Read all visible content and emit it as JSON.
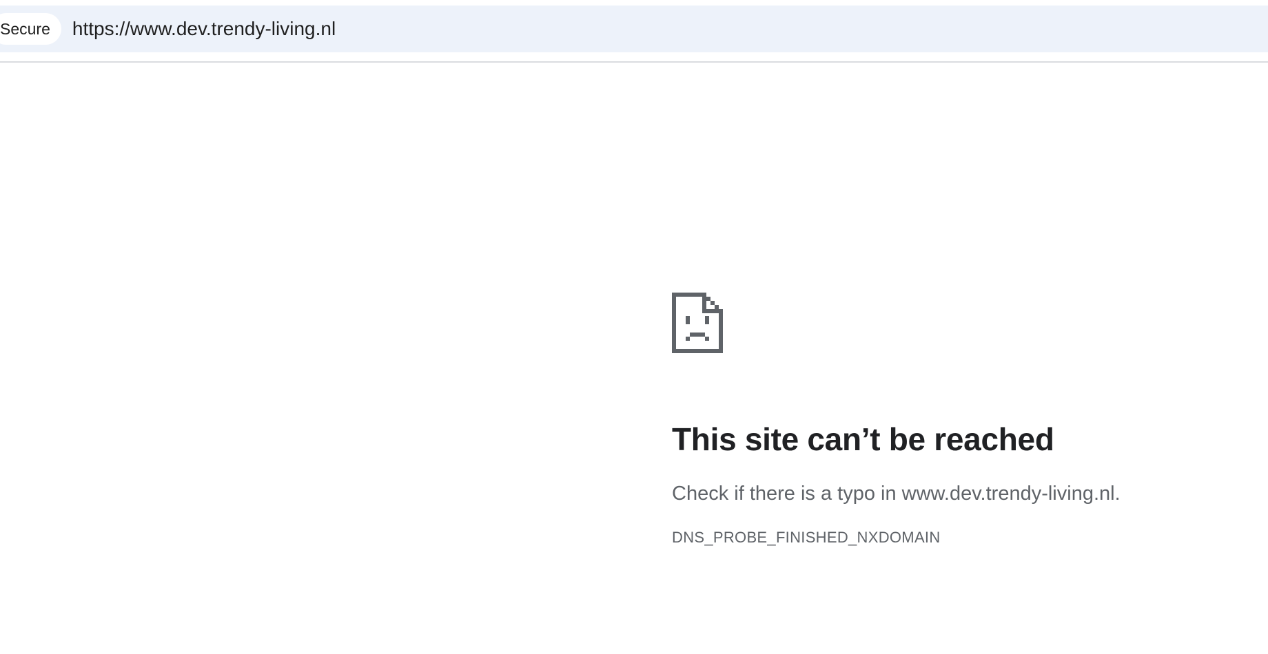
{
  "browser": {
    "security_chip": "Secure",
    "url": "https://www.dev.trendy-living.nl"
  },
  "error_page": {
    "icon": "sad-file-icon",
    "title": "This site can’t be reached",
    "description": "Check if there is a typo in www.dev.trendy-living.nl.",
    "error_code": "DNS_PROBE_FINISHED_NXDOMAIN"
  },
  "colors": {
    "omnibox_bg": "#edf2fa",
    "title_text": "#202124",
    "secondary_text": "#5f6368",
    "icon": "#5f6368"
  }
}
